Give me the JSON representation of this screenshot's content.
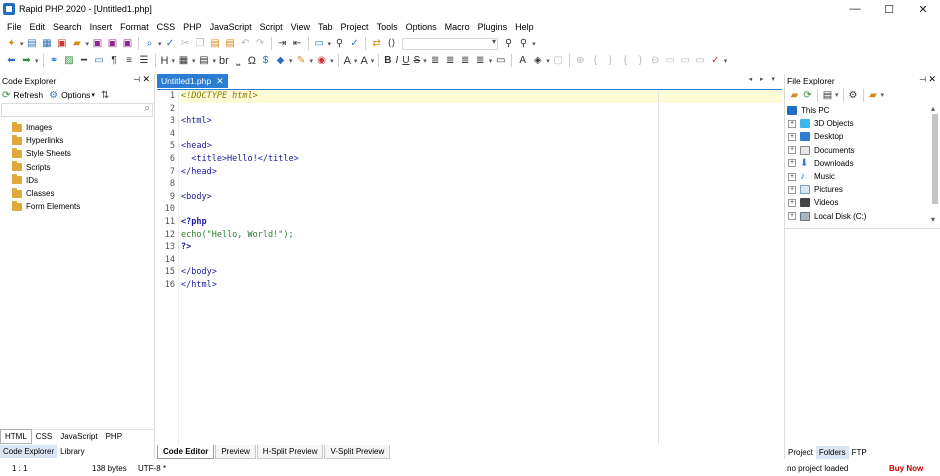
{
  "window": {
    "title": "Rapid PHP 2020 - [Untitled1.php]",
    "controls": [
      "—",
      "☐",
      "✕"
    ]
  },
  "menu": [
    "File",
    "Edit",
    "Search",
    "Insert",
    "Format",
    "CSS",
    "PHP",
    "JavaScript",
    "Script",
    "View",
    "Tab",
    "Project",
    "Tools",
    "Options",
    "Macro",
    "Plugins",
    "Help"
  ],
  "toolbar": {
    "heading_label": "H",
    "br_label": "br",
    "omega_label": "Ω",
    "bold_label": "B",
    "italic_label": "I",
    "underline_label": "U",
    "strike_label": "S",
    "font_a_label": "A",
    "font_a2_label": "A",
    "brace_label": "{¦}"
  },
  "code_explorer": {
    "title": "Code Explorer",
    "pin": "📌",
    "close": "✕",
    "refresh_label": "Refresh",
    "options_label": "Options",
    "search_placeholder": "",
    "items": [
      "Images",
      "Hyperlinks",
      "Style Sheets",
      "Scripts",
      "IDs",
      "Classes",
      "Form Elements"
    ],
    "lang_tabs": [
      "HTML",
      "CSS",
      "JavaScript",
      "PHP"
    ],
    "active_lang_tab": "HTML",
    "bottom_tabs": [
      "Code Explorer",
      "Library"
    ],
    "active_bottom_tab": "Code Explorer"
  },
  "editor": {
    "tab_label": "Untitled1.php",
    "tab_close": "✕",
    "nav_arrows": "◂ ▸ ▾",
    "line_numbers": [
      "1",
      "2",
      "3",
      "4",
      "5",
      "6",
      "7",
      "8",
      "9",
      "10",
      "11",
      "12",
      "13",
      "14",
      "15",
      "16"
    ],
    "current_line": 1,
    "lines": [
      "<!DOCTYPE html>",
      "",
      "<html>",
      "",
      "<head>",
      "  <title>Hello!</title>",
      "</head>",
      "",
      "<body>",
      "",
      "<?php",
      "echo(\"Hello, World!\");",
      "?>",
      "",
      "</body>",
      "</html>"
    ],
    "view_tabs": [
      "Code Editor",
      "Preview",
      "H-Split Preview",
      "V-Split Preview"
    ],
    "active_view_tab": "Code Editor"
  },
  "file_explorer": {
    "title": "File Explorer",
    "pin": "📌",
    "close": "✕",
    "root": "This PC",
    "items": [
      "3D Objects",
      "Desktop",
      "Documents",
      "Downloads",
      "Music",
      "Pictures",
      "Videos",
      "Local Disk (C:)"
    ],
    "bottom_tabs": [
      "Project",
      "Folders",
      "FTP"
    ],
    "active_bottom_tab": "Folders"
  },
  "status": {
    "position": "1 : 1",
    "size": "138 bytes",
    "encoding": "UTF-8 *",
    "project": "no project loaded",
    "buy": "Buy Now"
  },
  "colors": {
    "accent": "#2b7cd3",
    "current_line": "#fffbd6",
    "buy_now": "#cc0000",
    "folder": "#e0a93b"
  }
}
